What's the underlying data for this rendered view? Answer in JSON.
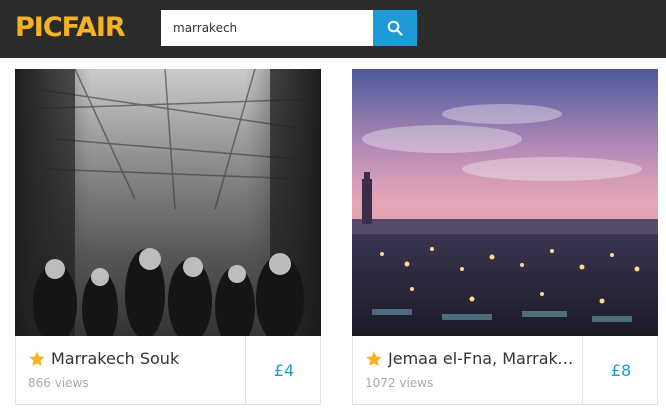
{
  "header": {
    "logo_text": "PICFAIR",
    "search": {
      "value": "marrakech",
      "placeholder": ""
    },
    "search_icon": "search-icon",
    "colors": {
      "bar": "#2b2b2b",
      "logo": "#f5b324",
      "accent": "#1e9ad6"
    }
  },
  "results": [
    {
      "title": "Marrakech Souk",
      "views": "866 views",
      "price": "£4",
      "featured_icon": "star-icon",
      "image": "black-and-white market street"
    },
    {
      "title": "Jemaa el-Fna, Marrakech",
      "views": "1072 views",
      "price": "£8",
      "featured_icon": "star-icon",
      "image": "square at dusk with minaret"
    }
  ]
}
